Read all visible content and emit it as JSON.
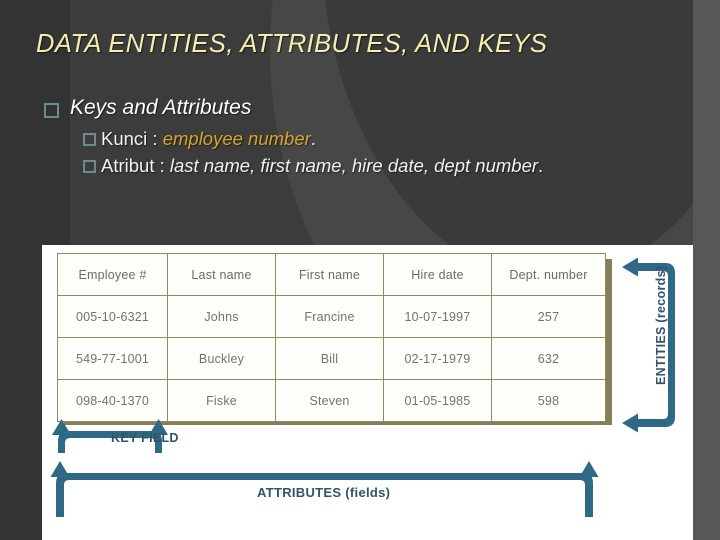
{
  "slide": {
    "title": "DATA ENTITIES, ATTRIBUTES, AND KEYS",
    "colors": {
      "background": "#3c3c3c",
      "title_text": "#f6edb0",
      "bullet_marker": "#6d8a91",
      "accent_gold": "#d6a62b",
      "annotation_blue": "#31546b",
      "bracket_blue": "#2f6985",
      "table_border": "#8f8a63",
      "table_shadow": "#857f55",
      "panel_background": "#ffffff"
    }
  },
  "bullets": {
    "level1": {
      "marker": "square-bullet-icon",
      "text": "Keys and Attributes"
    },
    "level2": [
      {
        "marker": "square-bullet-icon",
        "label": "Kunci : ",
        "value": "employee number",
        "suffix": ".",
        "emphasis": "gold"
      },
      {
        "marker": "square-bullet-icon",
        "label": "Atribut : ",
        "value": "last name, first name, hire date, dept number",
        "suffix": ".",
        "emphasis": "white"
      }
    ]
  },
  "table": {
    "headers": [
      "Employee #",
      "Last name",
      "First name",
      "Hire date",
      "Dept. number"
    ],
    "rows": [
      [
        "005-10-6321",
        "Johns",
        "Francine",
        "10-07-1997",
        "257"
      ],
      [
        "549-77-1001",
        "Buckley",
        "Bill",
        "02-17-1979",
        "632"
      ],
      [
        "098-40-1370",
        "Fiske",
        "Steven",
        "01-05-1985",
        "598"
      ]
    ]
  },
  "annotations": {
    "key_field": "KEY FIELD",
    "attributes": "ATTRIBUTES (fields)",
    "entities": "ENTITIES (records)"
  }
}
